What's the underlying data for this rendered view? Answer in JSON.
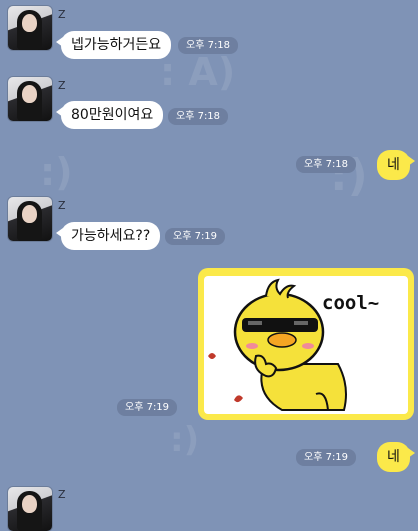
{
  "chat": {
    "messages": [
      {
        "sender": "Z",
        "text": "넵가능하거든요",
        "time": "오후 7:18"
      },
      {
        "sender": "Z",
        "text": "80만원이여요",
        "time": "오후 7:18"
      },
      {
        "me": true,
        "text": "네",
        "time": "오후 7:18"
      },
      {
        "sender": "Z",
        "text": "가능하세요??",
        "time": "오후 7:19"
      },
      {
        "me": true,
        "sticker": "cool-chick-sticker",
        "caption": "cool~",
        "time": "오후 7:19"
      },
      {
        "me": true,
        "text": "네",
        "time": "오후 7:19"
      },
      {
        "sender": "Z"
      }
    ]
  },
  "colors": {
    "background": "#7f93b6",
    "incoming_bubble": "#ffffff",
    "outgoing_bubble": "#fbe94a",
    "time_pill": "#6e7fa0"
  }
}
